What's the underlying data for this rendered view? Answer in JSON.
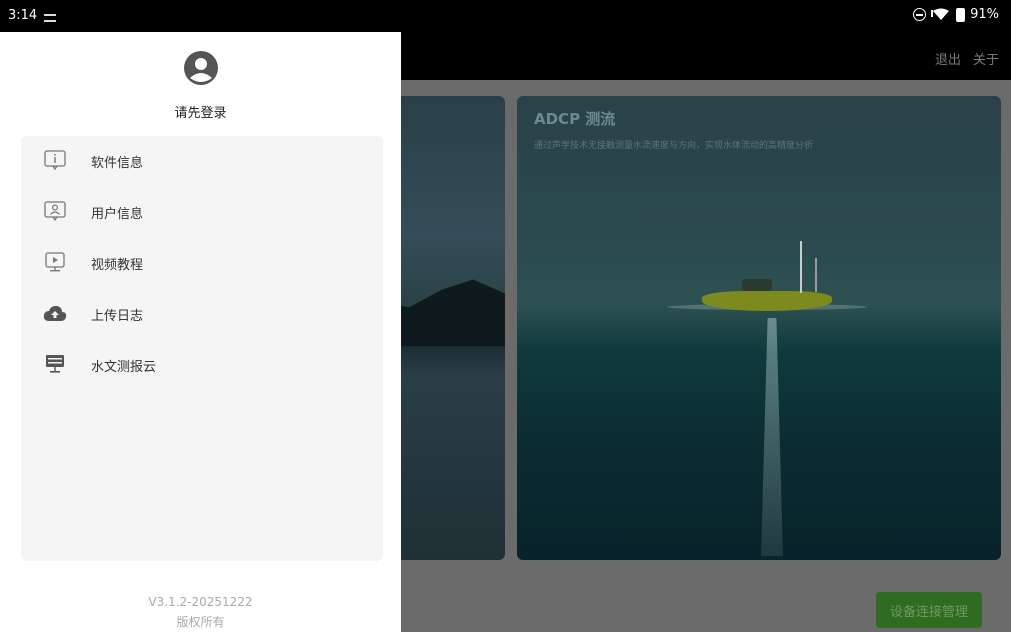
{
  "status_bar": {
    "time": "3:14",
    "battery": "91%"
  },
  "app_bar": {
    "logout_label": "退出",
    "about_label": "关于"
  },
  "cards": {
    "adcp": {
      "title": "ADCP 测流",
      "description": "通过声学技术无接触测量水流速度与方向，实现水体流动的高精度分析"
    }
  },
  "connect_button": "设备连接管理",
  "drawer": {
    "login_prompt": "请先登录",
    "menu": [
      {
        "label": "软件信息",
        "icon": "info-icon"
      },
      {
        "label": "用户信息",
        "icon": "user-icon"
      },
      {
        "label": "视频教程",
        "icon": "video-icon"
      },
      {
        "label": "上传日志",
        "icon": "cloud-upload-icon"
      },
      {
        "label": "水文测报云",
        "icon": "server-icon"
      }
    ],
    "version": "V3.1.2-20251222",
    "copyright": "版权所有"
  }
}
